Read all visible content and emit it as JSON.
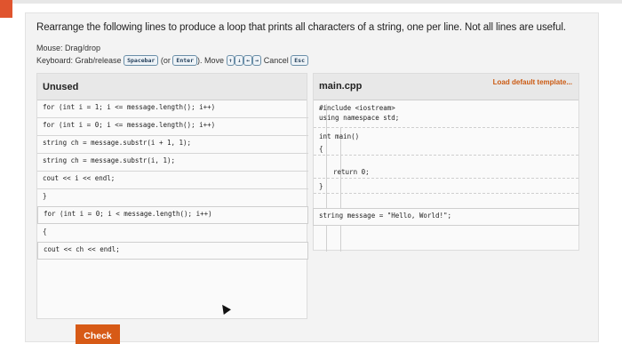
{
  "prompt": "Rearrange the following lines to produce a loop that prints all characters of a string, one per line. Not all lines are useful.",
  "instructions": {
    "mouse": "Mouse: Drag/drop",
    "keyboard_prefix": "Keyboard: Grab/release",
    "spacebar": "Spacebar",
    "or_open": "(or",
    "enter": "Enter",
    "close_move": "). Move",
    "up": "↑",
    "down": "↓",
    "left": "←",
    "right": "→",
    "cancel": "Cancel",
    "esc": "Esc"
  },
  "unused": {
    "title": "Unused",
    "lines": [
      "for (int i = 1; i <= message.length(); i++)",
      "for (int i = 0; i <= message.length(); i++)",
      "string ch = message.substr(i + 1, 1);",
      "string ch = message.substr(i, 1);",
      "cout << i << endl;",
      "}",
      "for (int i = 0; i < message.length(); i++)",
      "{",
      "cout << ch << endl;"
    ]
  },
  "main": {
    "title": "main.cpp",
    "load_label": "Load default template...",
    "include": "#include <iostream>",
    "using": "using namespace std;",
    "int_main": "int main()",
    "open_brace": "{",
    "ret": "return 0;",
    "close_brace": "}",
    "extra_line": "string message = \"Hello, World!\";"
  },
  "check_label": "Check"
}
